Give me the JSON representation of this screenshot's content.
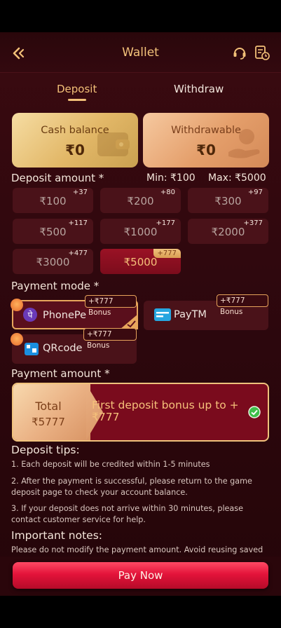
{
  "header": {
    "title": "Wallet"
  },
  "tabs": [
    {
      "label": "Deposit",
      "active": true
    },
    {
      "label": "Withdraw",
      "active": false
    }
  ],
  "balances": {
    "cash": {
      "label": "Cash balance",
      "value": "₹0"
    },
    "withdrawable": {
      "label": "Withdrawable",
      "value": "₹0"
    }
  },
  "deposit": {
    "heading": "Deposit amount *",
    "min": "Min: ₹100",
    "max": "Max: ₹5000",
    "amounts": [
      {
        "value": "₹100",
        "bonus": "+37"
      },
      {
        "value": "₹200",
        "bonus": "+80"
      },
      {
        "value": "₹300",
        "bonus": "+97"
      },
      {
        "value": "₹500",
        "bonus": "+117"
      },
      {
        "value": "₹1000",
        "bonus": "+177"
      },
      {
        "value": "₹2000",
        "bonus": "+377"
      },
      {
        "value": "₹3000",
        "bonus": "+477"
      },
      {
        "value": "₹5000",
        "bonus": "+777",
        "selected": true
      }
    ]
  },
  "payment_mode": {
    "heading": "Payment mode *",
    "methods": [
      {
        "name": "PhonePe",
        "bonus": "+₹777 Bonus",
        "selected": true
      },
      {
        "name": "PayTM",
        "bonus": "+₹777 Bonus"
      },
      {
        "name": "QRcode",
        "bonus": "+₹777 Bonus"
      }
    ]
  },
  "payment_amount": {
    "heading": "Payment amount *",
    "total_label": "Total",
    "total_value": "₹5777",
    "bonus_text": "First deposit bonus up to +₹777"
  },
  "tips": {
    "title": "Deposit tips:",
    "items": [
      "1. Each deposit will be credited within 1-5 minutes",
      "2. After the payment is successful, please return to the game deposit page to check your account balance.",
      "3. If your deposit does not arrive within 30 minutes, please contact customer service for help."
    ]
  },
  "notes": {
    "title": "Important notes:",
    "text": "Please do not modify the payment amount. Avoid reusing saved"
  },
  "pay_button": {
    "label": "Pay Now"
  },
  "colors": {
    "accent": "#f2c078",
    "primary_button": "#e3133a",
    "background": "#33090f"
  },
  "icons": [
    "back-icon",
    "customer-service-icon",
    "records-icon",
    "wallet-icon",
    "coin-hand-icon",
    "fire-icon",
    "phonepe-icon",
    "paytm-icon",
    "qrcode-icon",
    "check-icon"
  ]
}
